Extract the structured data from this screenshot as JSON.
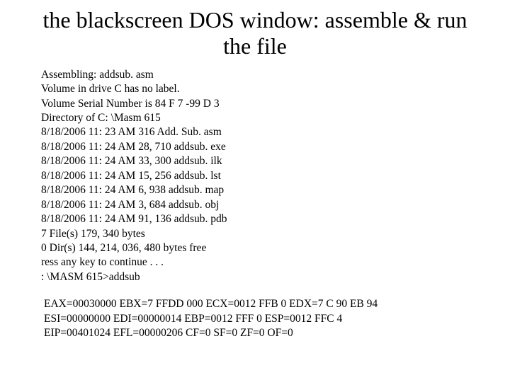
{
  "title": "the blackscreen DOS window: assemble & run the file",
  "console": {
    "assembling": " Assembling: addsub. asm",
    "vol1": "Volume in drive C has no label.",
    "vol2": "Volume Serial Number is 84 F 7 -99 D 3",
    "dir": "Directory of C: \\Masm 615",
    "f1": "8/18/2006  11: 23 AM                316 Add. Sub. asm",
    "f2": "8/18/2006  11: 24 AM             28, 710 addsub. exe",
    "f3": "8/18/2006  11: 24 AM             33, 300 addsub. ilk",
    "f4": "8/18/2006  11: 24 AM             15, 256 addsub. lst",
    "f5": "8/18/2006  11: 24 AM              6, 938 addsub. map",
    "f6": "8/18/2006  11: 24 AM              3, 684 addsub. obj",
    "f7": "8/18/2006  11: 24 AM             91, 136 addsub. pdb",
    "sum1": "           7 File(s)        179, 340 bytes",
    "sum2": "           0 Dir(s)   144, 214, 036, 480 bytes free",
    "press": "ress any key to continue . . .",
    "prompt": ": \\MASM 615>addsub"
  },
  "registers": {
    "r1": " EAX=00030000  EBX=7 FFDD 000  ECX=0012 FFB 0  EDX=7 C 90 EB 94",
    "r2": " ESI=00000000  EDI=00000014  EBP=0012 FFF 0  ESP=0012 FFC 4",
    "r3": " EIP=00401024  EFL=00000206  CF=0  SF=0  ZF=0  OF=0"
  }
}
